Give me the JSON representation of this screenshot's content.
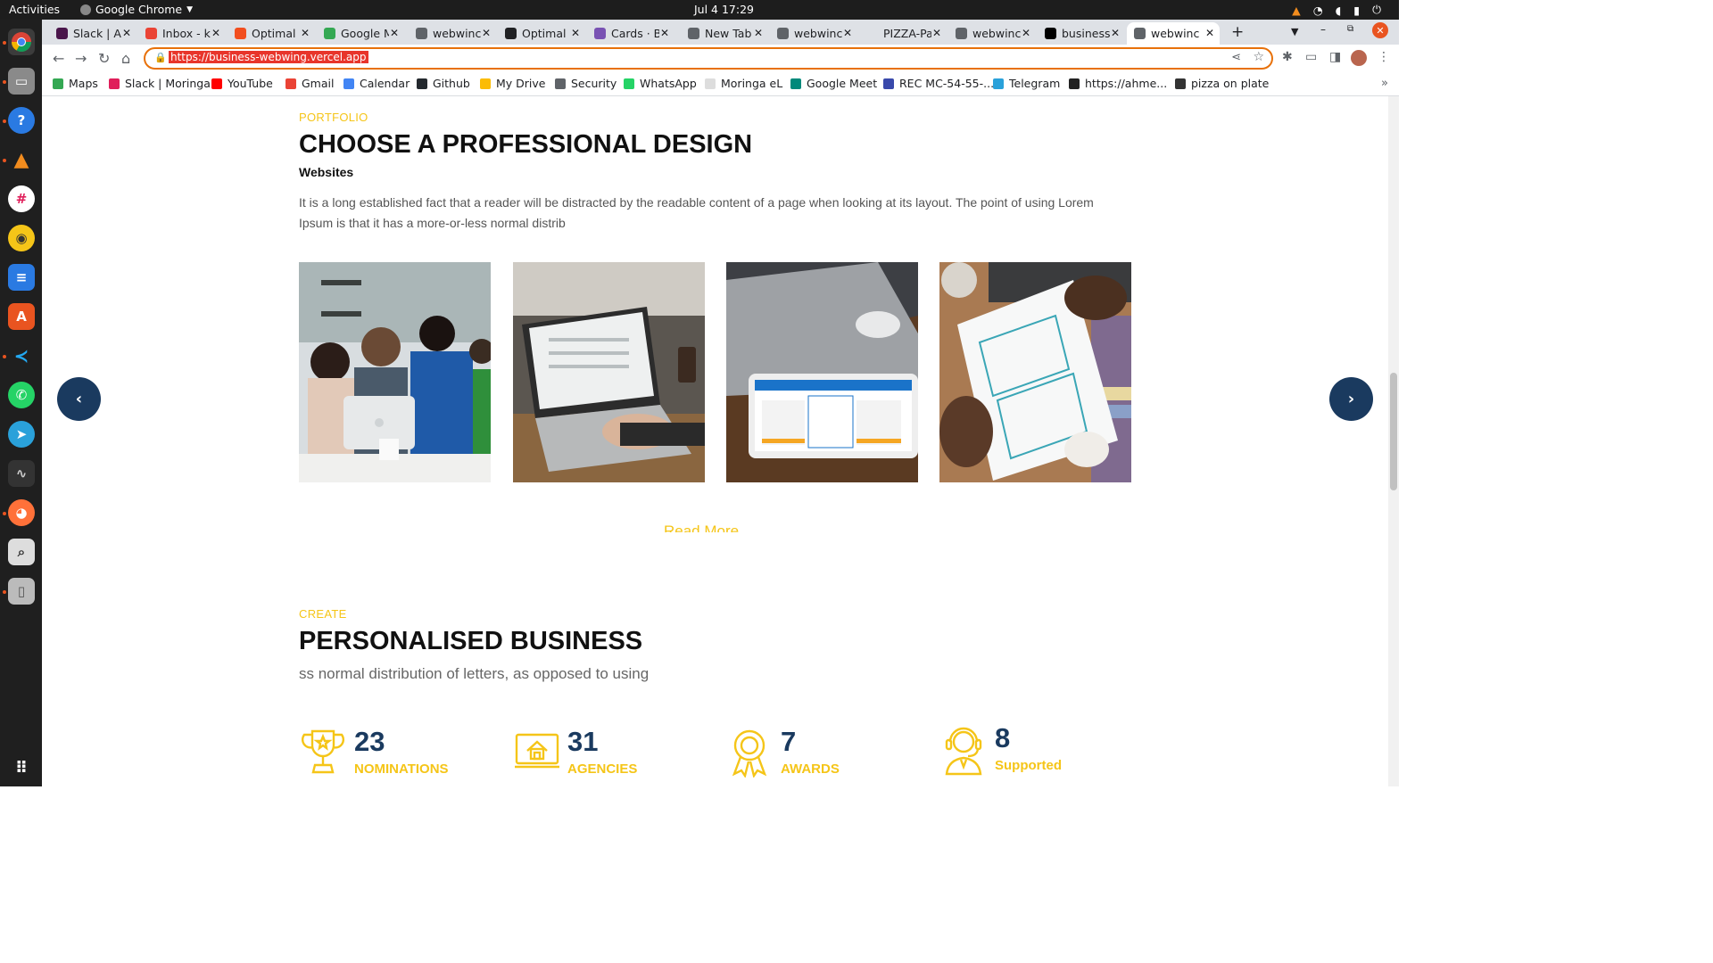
{
  "os": {
    "activities": "Activities",
    "app_name": "Google Chrome",
    "clock": "Jul 4  17:29"
  },
  "tabs": [
    {
      "label": "Slack | Al",
      "color": "#4a154b"
    },
    {
      "label": "Inbox - k",
      "color": "#ea4335"
    },
    {
      "label": "Optimal",
      "color": "#f24e1e"
    },
    {
      "label": "Google M",
      "color": "#34a853"
    },
    {
      "label": "webwinc",
      "color": "#5f6368"
    },
    {
      "label": "Optimal",
      "color": "#202124"
    },
    {
      "label": "Cards · B",
      "color": "#7952b3"
    },
    {
      "label": "New Tab",
      "color": "#5f6368"
    },
    {
      "label": "webwinc",
      "color": "#5f6368"
    },
    {
      "label": "PIZZA-Pa",
      "color": "#dee1e6"
    },
    {
      "label": "webwinc",
      "color": "#5f6368"
    },
    {
      "label": "business",
      "color": "#000000"
    },
    {
      "label": "webwinc",
      "color": "#5f6368"
    }
  ],
  "toolbar": {
    "url": "https://business-webwing.vercel.app"
  },
  "bookmarks": [
    {
      "label": "Maps",
      "color": "#34a853"
    },
    {
      "label": "Slack | Moringa",
      "color": "#e01e5a"
    },
    {
      "label": "YouTube",
      "color": "#ff0000"
    },
    {
      "label": "Gmail",
      "color": "#ea4335"
    },
    {
      "label": "Calendar",
      "color": "#4285f4"
    },
    {
      "label": "Github",
      "color": "#24292e"
    },
    {
      "label": "My Drive",
      "color": "#fbbc04"
    },
    {
      "label": "Security",
      "color": "#5f6368"
    },
    {
      "label": "WhatsApp",
      "color": "#25d366"
    },
    {
      "label": "Moringa eL",
      "color": "#dddddd"
    },
    {
      "label": "Google Meet",
      "color": "#00897b"
    },
    {
      "label": "REC MC-54-55-...",
      "color": "#3949ab"
    },
    {
      "label": "Telegram",
      "color": "#2aa1da"
    },
    {
      "label": "https://ahme...",
      "color": "#222222"
    },
    {
      "label": "pizza on plate",
      "color": "#333333"
    }
  ],
  "portfolio": {
    "eyebrow": "PORTFOLIO",
    "title": "CHOOSE A PROFESSIONAL DESIGN",
    "subtitle": "Websites",
    "body": "It is a long established fact that a reader will be distracted by the readable content of a page when looking at its layout. The point of using Lorem Ipsum is that it has a more-or-less normal distrib",
    "read_more": "Read More",
    "prev_icon": "chevron-left-icon",
    "next_icon": "chevron-right-icon"
  },
  "create": {
    "eyebrow": "CREATE",
    "title": "PERSONALISED BUSINESS",
    "tagline": "ss normal distribution of letters, as opposed to using"
  },
  "stats": [
    {
      "number": "23",
      "label": "NOMINATIONS",
      "icon": "trophy-icon"
    },
    {
      "number": "31",
      "label": "AGENCIES",
      "icon": "house-icon"
    },
    {
      "number": "7",
      "label": "AWARDS",
      "icon": "award-ribbon-icon"
    },
    {
      "number": "8",
      "label": "Supported",
      "icon": "support-agent-icon"
    }
  ],
  "colors": {
    "accent": "#f5c518",
    "navy": "#1a3a5f"
  }
}
